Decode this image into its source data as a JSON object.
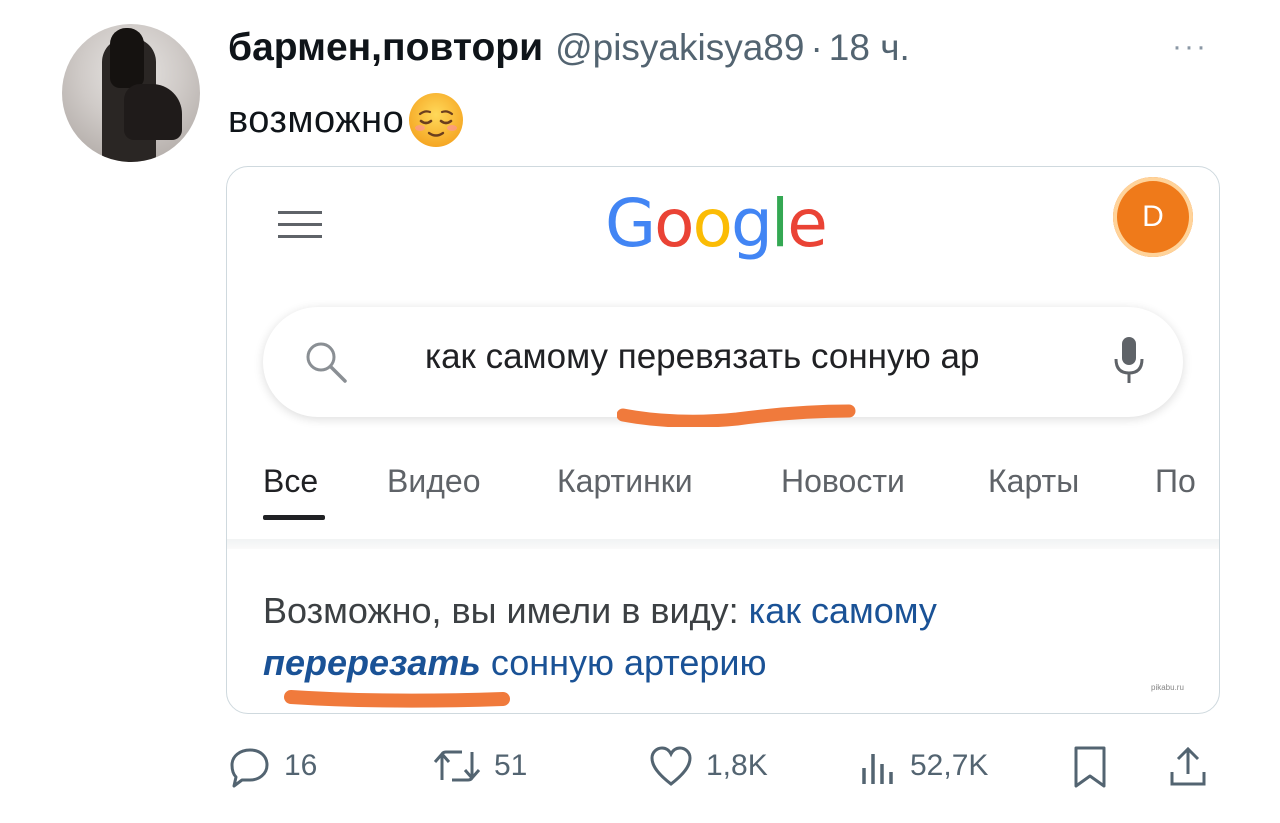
{
  "tweet": {
    "display_name": "бармен,повтори",
    "handle": "@pisyakisya89",
    "separator": "·",
    "time": "18 ч.",
    "more": "···",
    "text": "возможно",
    "emoji": "relieved-face"
  },
  "screenshot": {
    "logo": [
      "G",
      "o",
      "o",
      "g",
      "l",
      "e"
    ],
    "logo_colors": [
      "#4285F4",
      "#EA4335",
      "#FBBC05",
      "#4285F4",
      "#34A853",
      "#EA4335"
    ],
    "profile_letter": "D",
    "profile_color": "#ef7a1a",
    "query": "как самому перевязать сонную ар",
    "tabs": [
      "Все",
      "Видео",
      "Картинки",
      "Новости",
      "Карты",
      "По"
    ],
    "suggestion_prefix": "Возможно, вы имели в виду: ",
    "suggestion_link_1": "как самому",
    "suggestion_link_em": "перерезать",
    "suggestion_link_2": " сонную артерию",
    "watermark": "pikabu.ru",
    "highlight_color": "#f07a3c"
  },
  "actions": {
    "replies": "16",
    "retweets": "51",
    "likes": "1,8K",
    "views": "52,7K"
  }
}
